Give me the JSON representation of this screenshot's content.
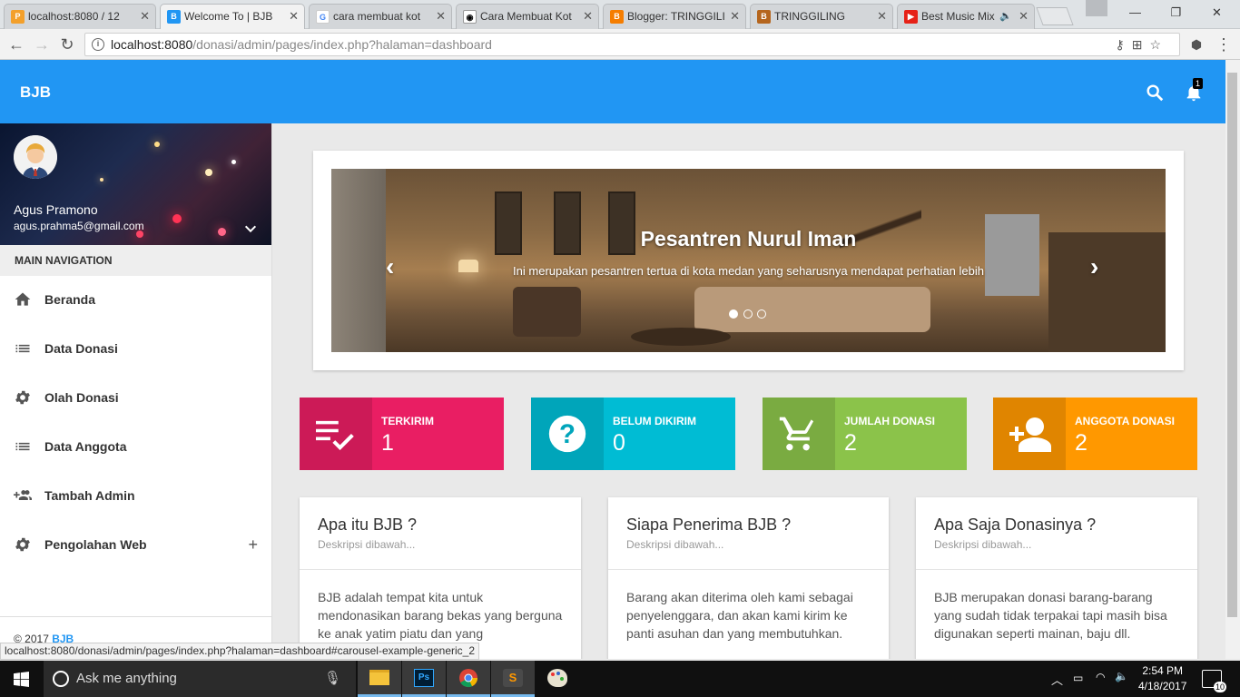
{
  "browser": {
    "tabs": [
      {
        "title": "localhost:8080 / 12",
        "favicon": "pma",
        "active": false
      },
      {
        "title": "Welcome To | BJB",
        "favicon": "bjb",
        "active": true
      },
      {
        "title": "cara membuat kot",
        "favicon": "google",
        "active": false
      },
      {
        "title": "Cara Membuat Kot",
        "favicon": "panda",
        "active": false
      },
      {
        "title": "Blogger: TRINGGILI",
        "favicon": "blogger",
        "active": false
      },
      {
        "title": "TRINGGILING",
        "favicon": "blogger-b",
        "active": false
      },
      {
        "title": "Best Music Mix",
        "favicon": "youtube",
        "active": false
      }
    ],
    "url_host": "localhost:8080",
    "url_path": "/donasi/admin/pages/index.php?halaman=dashboard",
    "status_url": "localhost:8080/donasi/admin/pages/index.php?halaman=dashboard#carousel-example-generic_2"
  },
  "app": {
    "brand": "BJB",
    "notification_count": "1",
    "accent_color": "#2196f3"
  },
  "sidebar": {
    "user_name": "Agus Pramono",
    "user_email": "agus.prahma5@gmail.com",
    "nav_header": "MAIN NAVIGATION",
    "items": [
      {
        "label": "Beranda",
        "icon": "home-icon"
      },
      {
        "label": "Data Donasi",
        "icon": "list-icon"
      },
      {
        "label": "Olah Donasi",
        "icon": "gear-icon"
      },
      {
        "label": "Data Anggota",
        "icon": "list-icon"
      },
      {
        "label": "Tambah Admin",
        "icon": "group-add-icon"
      },
      {
        "label": "Pengolahan Web",
        "icon": "gear-icon"
      }
    ],
    "footer_prefix": "© 2017",
    "footer_brand": "BJB"
  },
  "carousel": {
    "title": "Pesantren Nurul Iman",
    "text": "Ini merupakan pesantren tertua di kota medan yang seharusnya mendapat perhatian lebih",
    "slides": 3,
    "active_slide": 1
  },
  "infoboxes": [
    {
      "label": "TERKIRIM",
      "value": "1",
      "color": "#e91e63",
      "icon": "playlist-check-icon"
    },
    {
      "label": "BELUM DIKIRIM",
      "value": "0",
      "color": "#00bcd4",
      "icon": "help-icon"
    },
    {
      "label": "JUMLAH DONASI",
      "value": "2",
      "color": "#8bc34a",
      "icon": "cart-icon"
    },
    {
      "label": "ANGGOTA DONASI",
      "value": "2",
      "color": "#ff9800",
      "icon": "person-add-icon"
    }
  ],
  "cards": [
    {
      "title": "Apa itu BJB ?",
      "subtitle": "Deskripsi dibawah...",
      "body": "BJB adalah tempat kita untuk mendonasikan barang bekas yang berguna ke anak yatim piatu dan yang"
    },
    {
      "title": "Siapa Penerima BJB ?",
      "subtitle": "Deskripsi dibawah...",
      "body": "Barang akan diterima oleh kami sebagai penyelenggara, dan akan kami kirim ke panti asuhan dan yang membutuhkan."
    },
    {
      "title": "Apa Saja Donasinya ?",
      "subtitle": "Deskripsi dibawah...",
      "body": "BJB merupakan donasi barang-barang yang sudah tidak terpakai tapi masih bisa digunakan seperti mainan, baju dll."
    }
  ],
  "taskbar": {
    "search_placeholder": "Ask me anything",
    "time": "2:54 PM",
    "date": "4/18/2017",
    "notification_count": "10"
  }
}
